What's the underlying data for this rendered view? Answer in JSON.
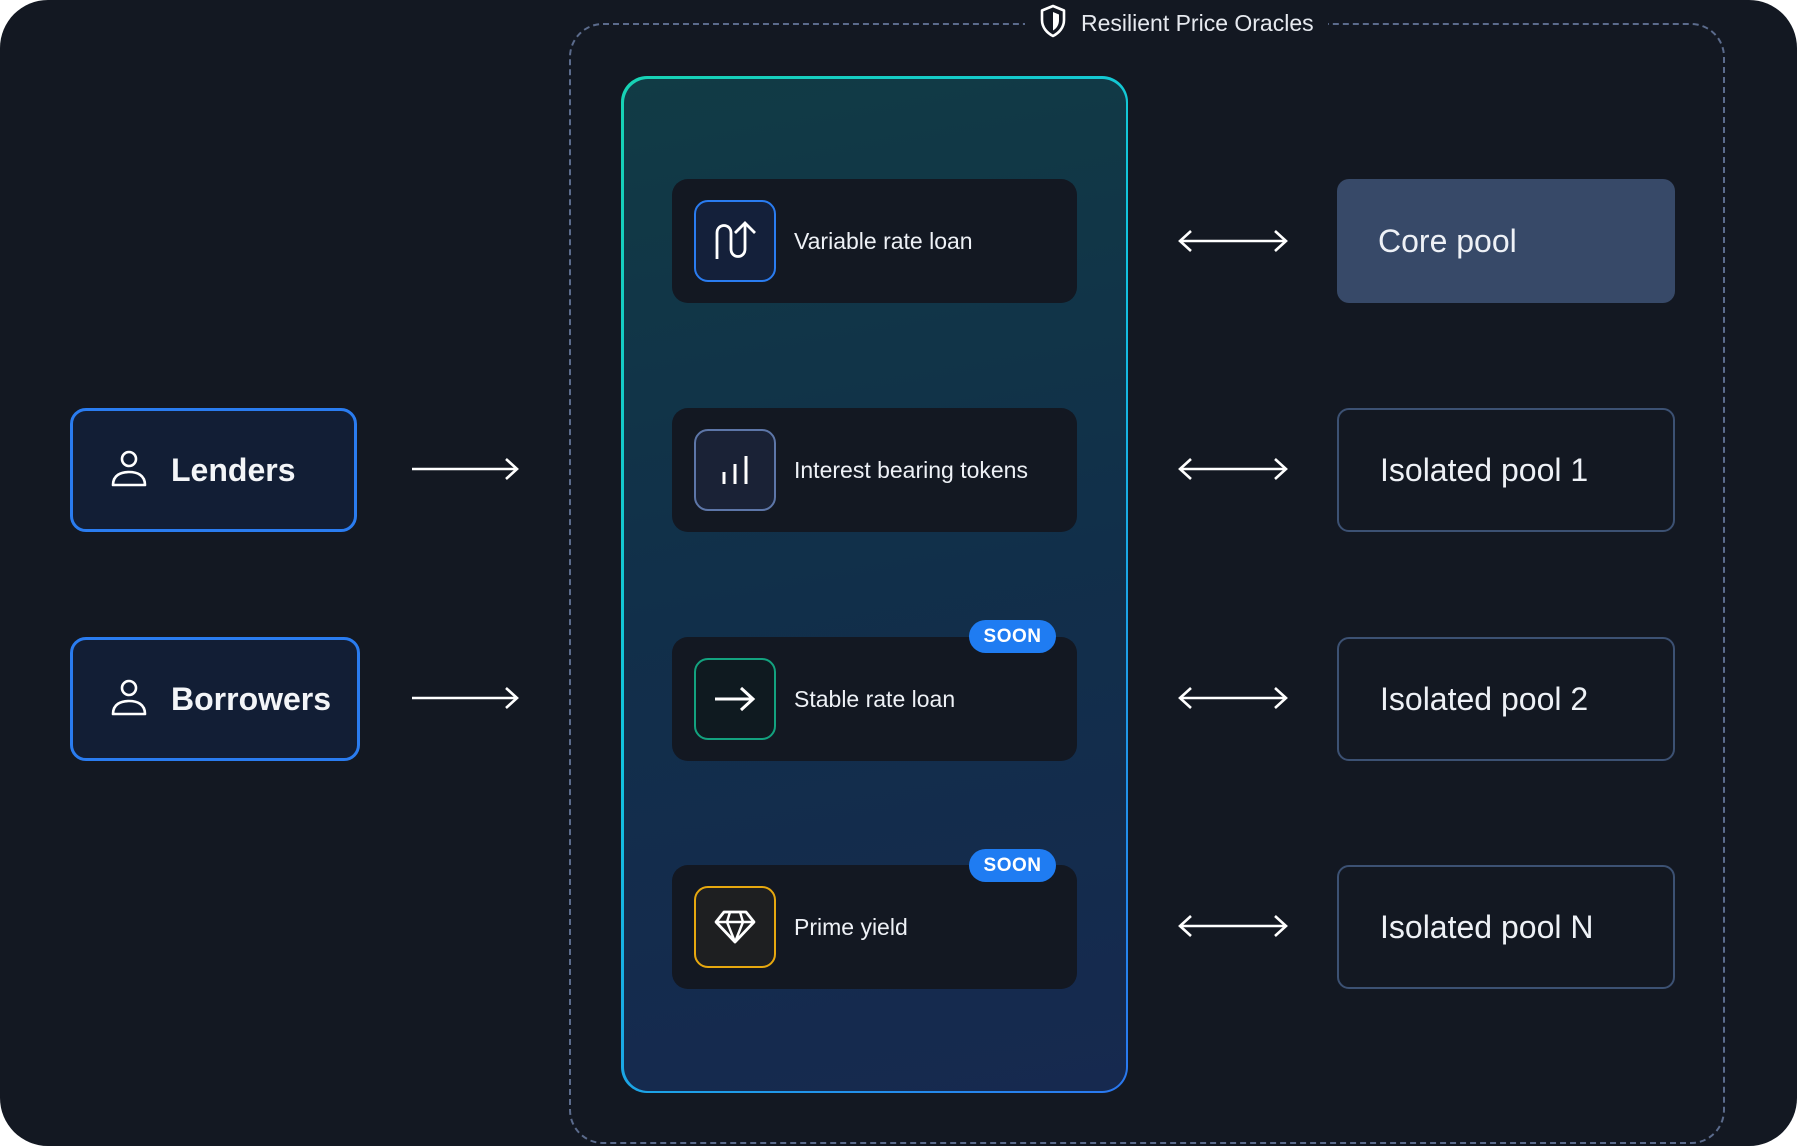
{
  "oracle": {
    "title": "Resilient Price Oracles",
    "icon": "shield-icon"
  },
  "actors": [
    {
      "label": "Lenders",
      "icon": "user-icon"
    },
    {
      "label": "Borrowers",
      "icon": "user-icon"
    }
  ],
  "features": [
    {
      "label": "Variable rate loan",
      "icon": "variable-rate-icon",
      "accent": "#2a7cf0",
      "badge": null
    },
    {
      "label": "Interest bearing tokens",
      "icon": "bar-chart-icon",
      "accent": "#5d76a8",
      "badge": null
    },
    {
      "label": "Stable rate loan",
      "icon": "arrow-right-icon",
      "accent": "#13a27f",
      "badge": "SOON"
    },
    {
      "label": "Prime yield",
      "icon": "diamond-icon",
      "accent": "#e7a80f",
      "badge": "SOON"
    }
  ],
  "pools": [
    {
      "label": "Core pool",
      "type": "core"
    },
    {
      "label": "Isolated pool 1",
      "type": "isolated"
    },
    {
      "label": "Isolated pool 2",
      "type": "isolated"
    },
    {
      "label": "Isolated pool N",
      "type": "isolated"
    }
  ],
  "colors": {
    "background": "#131822",
    "actor_border": "#2a7cf0",
    "badge": "#1f7cf2",
    "core_pool": "#374968",
    "isolated_border": "#3c5173",
    "dashed": "#5b6b8c"
  }
}
